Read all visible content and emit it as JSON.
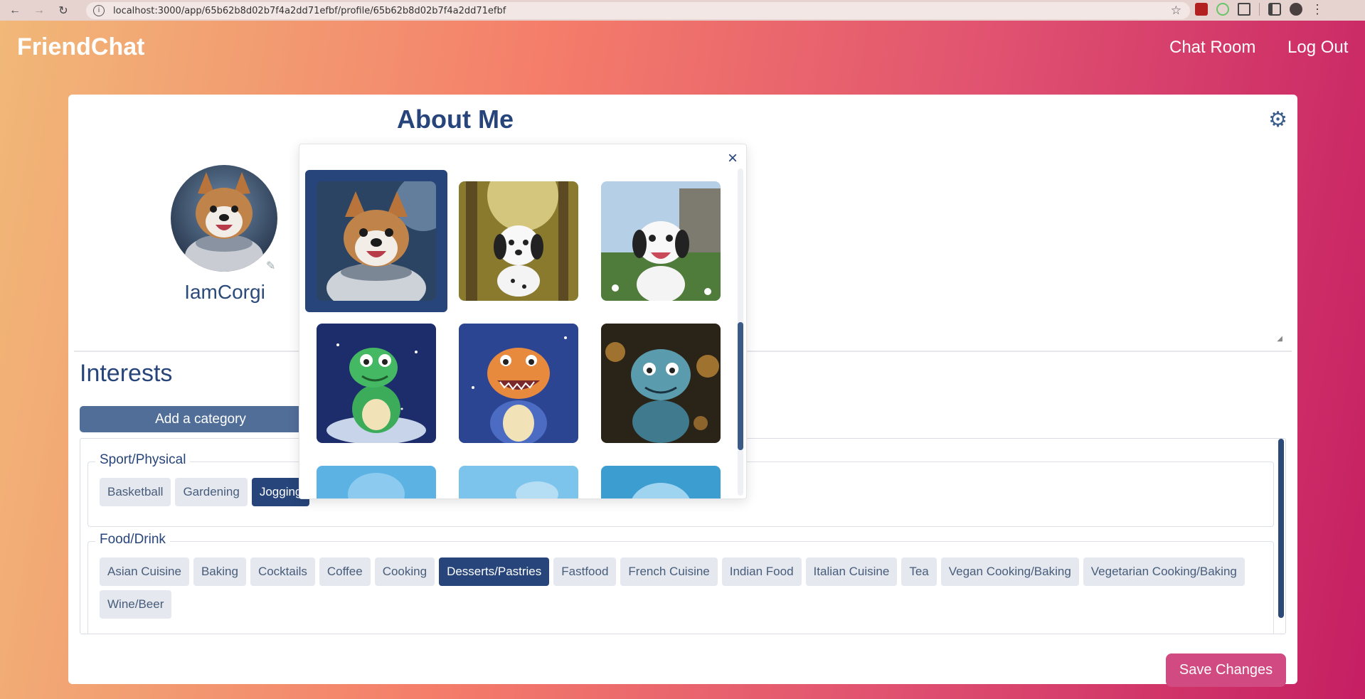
{
  "browser": {
    "url": "localhost:3000/app/65b62b8d02b7f4a2dd71efbf/profile/65b62b8d02b7f4a2dd71efbf"
  },
  "header": {
    "logo": "FriendChat",
    "nav": {
      "chat_room": "Chat Room",
      "log_out": "Log Out"
    }
  },
  "profile": {
    "about_title": "About Me",
    "username": "IamCorgi"
  },
  "interests": {
    "title": "Interests",
    "add_category": "Add a category",
    "categories": [
      {
        "name": "Sport/Physical",
        "items": [
          {
            "label": "Basketball",
            "selected": false
          },
          {
            "label": "Gardening",
            "selected": false
          },
          {
            "label": "Jogging",
            "selected": true
          }
        ]
      },
      {
        "name": "Food/Drink",
        "items": [
          {
            "label": "Asian Cuisine",
            "selected": false
          },
          {
            "label": "Baking",
            "selected": false
          },
          {
            "label": "Cocktails",
            "selected": false
          },
          {
            "label": "Coffee",
            "selected": false
          },
          {
            "label": "Cooking",
            "selected": false
          },
          {
            "label": "Desserts/Pastries",
            "selected": true
          },
          {
            "label": "Fastfood",
            "selected": false
          },
          {
            "label": "French Cuisine",
            "selected": false
          },
          {
            "label": "Indian Food",
            "selected": false
          },
          {
            "label": "Italian Cuisine",
            "selected": false
          },
          {
            "label": "Tea",
            "selected": false
          },
          {
            "label": "Vegan Cooking/Baking",
            "selected": false
          },
          {
            "label": "Vegetarian Cooking/Baking",
            "selected": false
          },
          {
            "label": "Wine/Beer",
            "selected": false
          }
        ]
      }
    ]
  },
  "actions": {
    "save": "Save Changes"
  },
  "avatar_picker": {
    "close_icon": "close-icon",
    "options": [
      {
        "subject": "corgi-astronaut",
        "selected": true
      },
      {
        "subject": "dalmatian-forest",
        "selected": false
      },
      {
        "subject": "dalmatian-garden",
        "selected": false
      },
      {
        "subject": "green-dino-space",
        "selected": false
      },
      {
        "subject": "orange-dino-space",
        "selected": false
      },
      {
        "subject": "teal-dino-lights",
        "selected": false
      },
      {
        "subject": "underwater-1",
        "selected": false
      },
      {
        "subject": "underwater-2",
        "selected": false
      },
      {
        "subject": "underwater-3",
        "selected": false
      }
    ]
  },
  "colors": {
    "primary": "#27457a",
    "save_button": "#d14a82",
    "chip_bg": "#e5e9ef"
  }
}
